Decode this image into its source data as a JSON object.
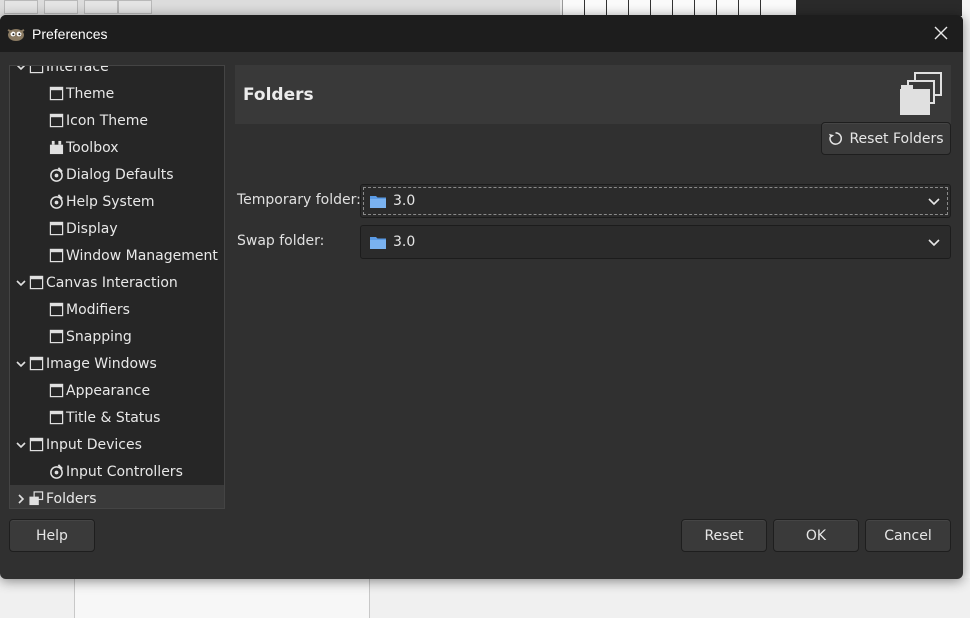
{
  "window": {
    "title": "Preferences"
  },
  "tree": {
    "items": [
      {
        "label": "Interface",
        "level": 0,
        "expanded": true,
        "icon": "interface-icon"
      },
      {
        "label": "Theme",
        "level": 1,
        "icon": "theme-icon"
      },
      {
        "label": "Icon Theme",
        "level": 1,
        "icon": "icon-theme-icon"
      },
      {
        "label": "Toolbox",
        "level": 1,
        "icon": "toolbox-icon"
      },
      {
        "label": "Dialog Defaults",
        "level": 1,
        "icon": "dialog-defaults-icon"
      },
      {
        "label": "Help System",
        "level": 1,
        "icon": "help-system-icon"
      },
      {
        "label": "Display",
        "level": 1,
        "icon": "display-icon"
      },
      {
        "label": "Window Management",
        "level": 1,
        "icon": "window-management-icon"
      },
      {
        "label": "Canvas Interaction",
        "level": 0,
        "expanded": true,
        "icon": "canvas-icon"
      },
      {
        "label": "Modifiers",
        "level": 1,
        "icon": "modifiers-icon"
      },
      {
        "label": "Snapping",
        "level": 1,
        "icon": "snapping-icon"
      },
      {
        "label": "Image Windows",
        "level": 0,
        "expanded": true,
        "icon": "image-windows-icon"
      },
      {
        "label": "Appearance",
        "level": 1,
        "icon": "appearance-icon"
      },
      {
        "label": "Title & Status",
        "level": 1,
        "icon": "title-status-icon"
      },
      {
        "label": "Input Devices",
        "level": 0,
        "expanded": true,
        "icon": "input-devices-icon"
      },
      {
        "label": "Input Controllers",
        "level": 1,
        "icon": "input-controllers-icon"
      },
      {
        "label": "Folders",
        "level": 0,
        "expanded": false,
        "selected": true,
        "icon": "folders-icon"
      }
    ]
  },
  "content": {
    "title": "Folders",
    "reset_folders_label": "Reset Folders",
    "fields": [
      {
        "label": "Temporary folder:",
        "value": "3.0"
      },
      {
        "label": "Swap folder:",
        "value": "3.0"
      }
    ]
  },
  "buttons": {
    "help": "Help",
    "reset": "Reset",
    "ok": "OK",
    "cancel": "Cancel"
  },
  "colors": {
    "dialog_bg": "#303030",
    "titlebar_bg": "#1d1d1d",
    "tree_bg": "#262626",
    "selection_bg": "#3a3a3a",
    "folder_blue": "#5a9be6"
  }
}
